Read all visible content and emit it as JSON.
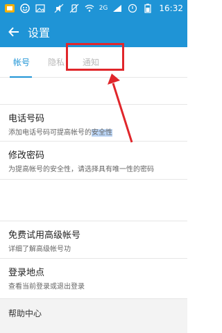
{
  "status": {
    "time": "16:32",
    "network": "2G"
  },
  "appbar": {
    "title": "设置"
  },
  "tabs": [
    {
      "label": "帐号",
      "active": true
    },
    {
      "label": "隐私",
      "active": false
    },
    {
      "label": "通知",
      "active": false
    }
  ],
  "settings": {
    "phone": {
      "title": "电话号码",
      "desc_prefix": "添加电话号码可提高帐号的",
      "desc_highlight": "安全性"
    },
    "password": {
      "title": "修改密码",
      "desc": "为提高帐号的安全性，请选择具有唯一性的密码"
    },
    "premium": {
      "title": "免费试用高级帐号",
      "desc": "详细了解高级帐号功"
    },
    "login": {
      "title": "登录地点",
      "desc": "查看当前登录或退出登录"
    },
    "help": {
      "title": "帮助中心"
    }
  },
  "colors": {
    "accent": "#1f94d6",
    "annotation": "#e0262b"
  }
}
